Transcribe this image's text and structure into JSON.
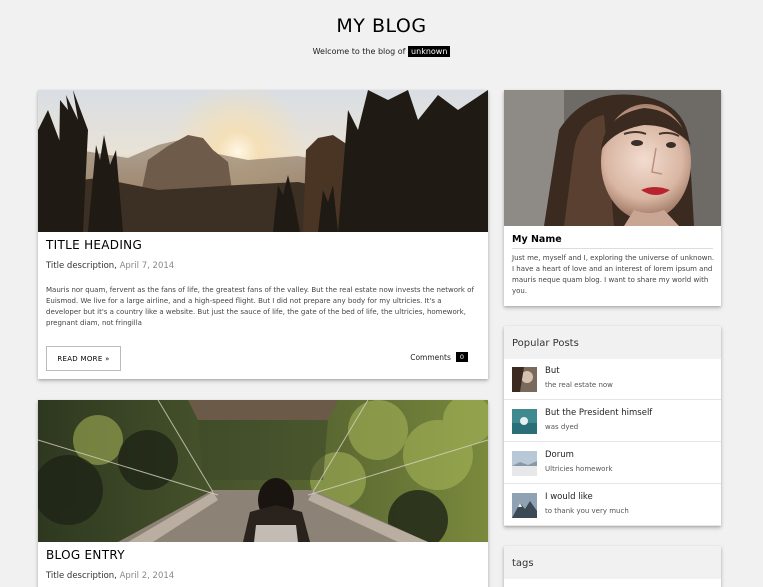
{
  "header": {
    "title": "MY BLOG",
    "tagline_prefix": "Welcome to the blog of",
    "tagline_tag": "unknown"
  },
  "posts": [
    {
      "title": "TITLE HEADING",
      "description": "Title description,",
      "date": "April 7, 2014",
      "excerpt": "Mauris nor quam, fervent as the fans of life, the greatest fans of the valley. But the real estate now invests the network of Euismod. We live for a large airline, and a high-speed flight. But I did not prepare any body for my ultricies. It's a developer but it's a country like a website. But just the sauce of life, the gate of the bed of life, the ultricies, homework, pregnant diam, not fringilla",
      "read_more": "READ MORE »",
      "comments_label": "Comments",
      "comments_count": "0"
    },
    {
      "title": "BLOG ENTRY",
      "description": "Title description,",
      "date": "April 2, 2014"
    }
  ],
  "profile": {
    "name": "My Name",
    "bio": "Just me, myself and I, exploring the universe of unknown. I have a heart of love and an interest of lorem ipsum and mauris neque quam blog. I want to share my world with you."
  },
  "popular_posts": {
    "heading": "Popular Posts",
    "items": [
      {
        "title": "But",
        "subtitle": "the real estate now"
      },
      {
        "title": "But the President himself",
        "subtitle": "was dyed"
      },
      {
        "title": "Dorum",
        "subtitle": "Ultricies homework"
      },
      {
        "title": "I would like",
        "subtitle": "to thank you very much"
      }
    ]
  },
  "tags_widget": {
    "heading": "tags"
  },
  "colors": {
    "page_background": "#f1f1f1",
    "card_background": "#ffffff",
    "date_text": "#888888",
    "tag_chip": "#000000"
  }
}
